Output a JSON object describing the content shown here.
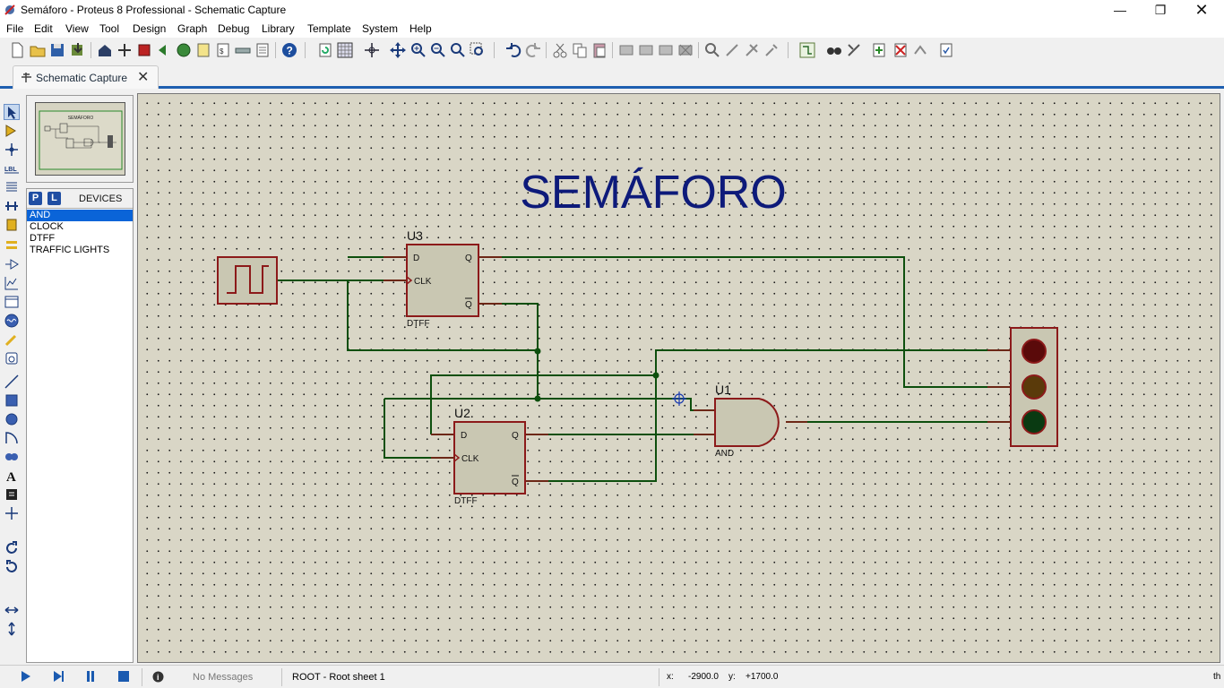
{
  "window": {
    "title": "Semáforo - Proteus 8 Professional - Schematic Capture"
  },
  "menu": [
    "File",
    "Edit",
    "View",
    "Tool",
    "Design",
    "Graph",
    "Debug",
    "Library",
    "Template",
    "System",
    "Help"
  ],
  "tab": {
    "label": "Schematic Capture"
  },
  "devices": {
    "p_label": "P",
    "l_label": "L",
    "title": "DEVICES",
    "items": [
      "AND",
      "CLOCK",
      "DTFF",
      "TRAFFIC LIGHTS"
    ],
    "selected": "AND"
  },
  "rotation": "0°",
  "overview": {
    "mini_title": "SEMÁFORO"
  },
  "schematic": {
    "title": "SEMÁFORO",
    "u3": {
      "ref": "U3",
      "type": "DTFF",
      "pin_d": "D",
      "pin_clk": "CLK",
      "pin_q": "Q",
      "pin_qbar": "Q"
    },
    "u2": {
      "ref": "U2",
      "type": "DTFF",
      "pin_d": "D",
      "pin_clk": "CLK",
      "pin_q": "Q",
      "pin_qbar": "Q"
    },
    "u1": {
      "ref": "U1",
      "type": "AND"
    },
    "traffic_light_colors": {
      "red": "#5a0a0a",
      "yellow": "#5a3a0a",
      "green": "#0a3a12"
    }
  },
  "status": {
    "messages": "No Messages",
    "sheet": "ROOT - Root sheet 1",
    "x_label": "x:",
    "x_value": "-2900.0",
    "y_label": "y:",
    "y_value": "+1700.0",
    "units": "th"
  },
  "colors": {
    "wire": "#0d4f0d",
    "component_outline": "#8c1a1a",
    "component_fill": "#c9c7b2",
    "title": "#0d1a7a",
    "junction": "#0d4f0d",
    "selection": "#0a64d8"
  }
}
